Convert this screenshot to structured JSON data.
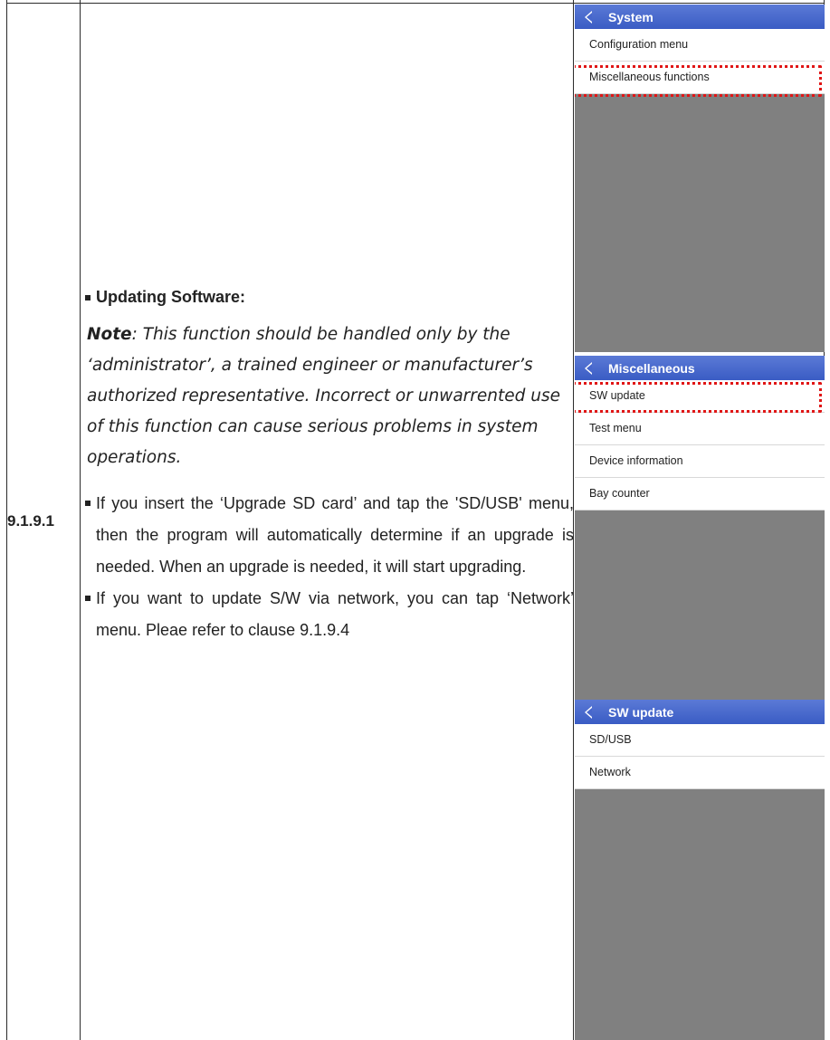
{
  "clause_number": "9.1.9.1",
  "heading": "Updating Software:",
  "note": {
    "label": "Note",
    "text": ": This function should be handled only by the ‘administrator’, a trained engineer or manufacturer’s authorized representative. Incorrect or unwarrented use of this function can cause serious problems in system operations."
  },
  "bullets": [
    "If you insert the ‘Upgrade SD card’ and tap  the 'SD/USB' menu, then the program will automatically determine if an upgrade is needed. When an upgrade is needed, it will start upgrading.",
    "If you want to update S/W via network, you can tap ‘Network’ menu. Pleae refer to clause 9.1.9.4"
  ],
  "screens": [
    {
      "title": "System",
      "items": [
        "Configuration menu",
        "Miscellaneous functions"
      ],
      "highlighted": "Miscellaneous functions"
    },
    {
      "title": "Miscellaneous",
      "items": [
        "SW update",
        "Test menu",
        "Device information",
        "Bay counter"
      ],
      "highlighted": "SW update"
    },
    {
      "title": "SW update",
      "items": [
        "SD/USB",
        "Network"
      ],
      "highlighted": ""
    }
  ],
  "colors": {
    "titlebar": "#4a69cc",
    "highlight": "#e01616",
    "screen_bg": "#808080"
  },
  "icons": [
    "back-arrow-icon"
  ]
}
